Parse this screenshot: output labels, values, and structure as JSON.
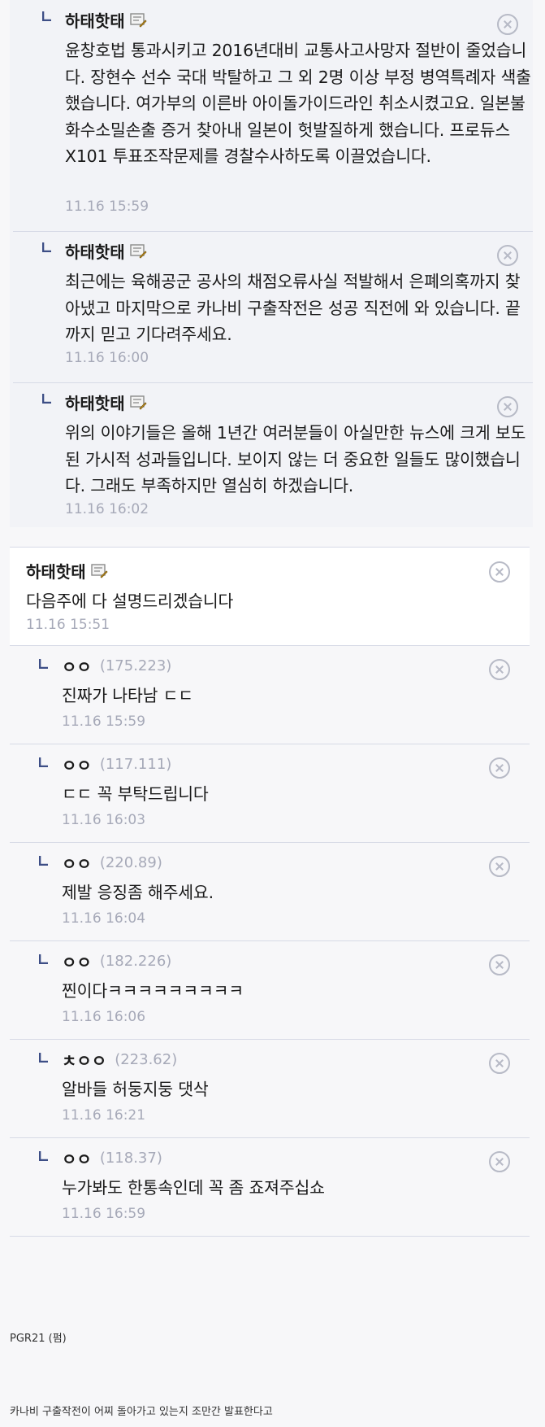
{
  "nested_replies": [
    {
      "author": "하태핫태",
      "text": "윤창호법 통과시키고 2016년대비 교통사고사망자 절반이 줄었습니다. 장현수 선수 국대 박탈하고 그 외 2명 이상 부정 병역특례자 색출했습니다. 여가부의 이른바 아이돌가이드라인 취소시켰고요. 일본불화수소밀손출 증거 찾아내 일본이 헛발질하게 했습니다. 프로듀스X101 투표조작문제를 경찰수사하도록 이끌었습니다.",
      "time": "11.16 15:59"
    },
    {
      "author": "하태핫태",
      "text": "최근에는 육해공군 공사의 채점오류사실 적발해서 은폐의혹까지 찾아냈고 마지막으로 카나비 구출작전은 성공 직전에 와 있습니다. 끝까지 믿고 기다려주세요.",
      "time": "11.16 16:00"
    },
    {
      "author": "하태핫태",
      "text": "위의 이야기들은 올해 1년간 여러분들이 아실만한 뉴스에 크게 보도된 가시적 성과들입니다. 보이지 않는 더 중요한 일들도 많이했습니다. 그래도 부족하지만 열심히 하겠습니다.",
      "time": "11.16 16:02"
    }
  ],
  "main_comment": {
    "author": "하태핫태",
    "text": "다음주에 다 설명드리겠습니다",
    "time": "11.16 15:51"
  },
  "replies": [
    {
      "author": "ㅇㅇ",
      "ip": "(175.223)",
      "text": "진짜가 나타남 ㄷㄷ",
      "time": "11.16 15:59"
    },
    {
      "author": "ㅇㅇ",
      "ip": "(117.111)",
      "text": "ㄷㄷ 꼭 부탁드립니다",
      "time": "11.16 16:03"
    },
    {
      "author": "ㅇㅇ",
      "ip": "(220.89)",
      "text": "제발 응징좀 해주세요.",
      "time": "11.16 16:04"
    },
    {
      "author": "ㅇㅇ",
      "ip": "(182.226)",
      "text": "찐이다ㅋㅋㅋㅋㅋㅋㅋㅋㅋ",
      "time": "11.16 16:06"
    },
    {
      "author": "ㅊㅇㅇ",
      "ip": "(223.62)",
      "text": "알바들 허둥지둥 댓삭",
      "time": "11.16 16:21"
    },
    {
      "author": "ㅇㅇ",
      "ip": "(118.37)",
      "text": "누가봐도 한통속인데 꼭 좀 죠져주십쇼",
      "time": "11.16 16:59"
    }
  ],
  "footer": {
    "source": "PGR21 (펌)",
    "caption": "카나비 구출작전이 어찌 돌아가고 있는지 조만간 발표한다고"
  },
  "colors": {
    "reply_panel_bg": "#f2f3f7",
    "divider": "#d7dae6",
    "timestamp": "#a6a9b8",
    "reply_marker": "#3d4e86"
  },
  "icons": [
    "reply-marker-icon",
    "author-badge-icon",
    "delete-icon"
  ]
}
